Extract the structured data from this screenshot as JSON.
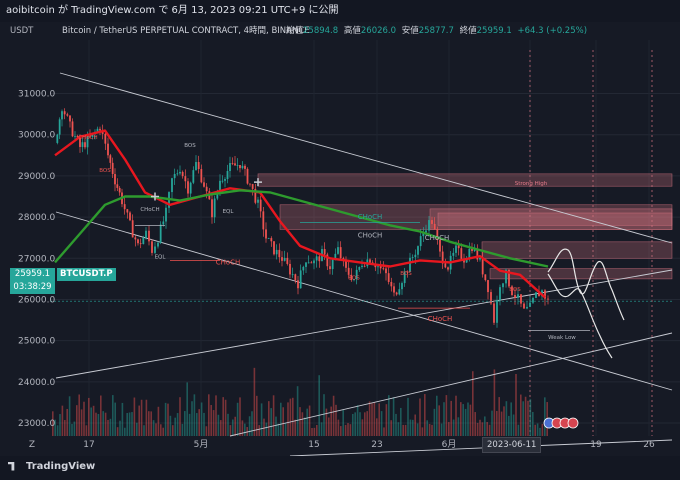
{
  "header": {
    "line": "aoibitcoin が TradingView.com で 6月 13, 2023 09:21 UTC+9 に公開"
  },
  "symbol_bar": {
    "currency": "USDT",
    "title": "Bitcoin / TetherUS PERPETUAL CONTRACT, 4時間, BINANCE",
    "ohlc": [
      {
        "label": "始値",
        "value": "25894.8"
      },
      {
        "label": "高値",
        "value": "26026.0"
      },
      {
        "label": "安値",
        "value": "25877.7"
      },
      {
        "label": "終値",
        "value": "25959.1"
      }
    ],
    "change": "+64.3 (+0.25%)"
  },
  "price_tag": {
    "price": "25959.1",
    "countdown": "03:38:29",
    "symbol": "BTCUSDT.P"
  },
  "cursor_date": "2023-06-11",
  "footer": {
    "brand": "TradingView"
  },
  "colors": {
    "background": "#161a25",
    "up": "#26a69a",
    "down": "#ef5350",
    "ma_fast": "#e8171f",
    "ma_slow": "#2e9b2e",
    "zone": "#d97583"
  },
  "chart_data": {
    "type": "candlestick",
    "title": "Bitcoin / TetherUS PERPETUAL CONTRACT, 4時間, BINANCE",
    "x_tick_labels": [
      "17",
      "5月",
      "15",
      "23",
      "6月",
      "12",
      "19",
      "26",
      "Z"
    ],
    "y_tick_labels": [
      "23000.0",
      "24000.0",
      "25000.0",
      "26000.0",
      "27000.0",
      "28000.0",
      "29000.0",
      "30000.0",
      "31000.0"
    ],
    "ylim": [
      22200,
      32300
    ],
    "last_close": 25959.1,
    "price_path": [
      {
        "x": 55,
        "p": 29800
      },
      {
        "x": 62,
        "p": 30700
      },
      {
        "x": 70,
        "p": 30200
      },
      {
        "x": 80,
        "p": 29700
      },
      {
        "x": 90,
        "p": 29900
      },
      {
        "x": 100,
        "p": 30200
      },
      {
        "x": 108,
        "p": 29500
      },
      {
        "x": 115,
        "p": 28900
      },
      {
        "x": 122,
        "p": 28400
      },
      {
        "x": 130,
        "p": 27800
      },
      {
        "x": 138,
        "p": 27300
      },
      {
        "x": 146,
        "p": 27600
      },
      {
        "x": 152,
        "p": 27200
      },
      {
        "x": 158,
        "p": 27500
      },
      {
        "x": 166,
        "p": 28100
      },
      {
        "x": 172,
        "p": 28900
      },
      {
        "x": 180,
        "p": 29200
      },
      {
        "x": 188,
        "p": 28700
      },
      {
        "x": 196,
        "p": 29300
      },
      {
        "x": 204,
        "p": 28800
      },
      {
        "x": 212,
        "p": 28100
      },
      {
        "x": 220,
        "p": 28900
      },
      {
        "x": 230,
        "p": 29200
      },
      {
        "x": 240,
        "p": 29300
      },
      {
        "x": 250,
        "p": 28800
      },
      {
        "x": 258,
        "p": 28300
      },
      {
        "x": 266,
        "p": 27500
      },
      {
        "x": 274,
        "p": 27200
      },
      {
        "x": 282,
        "p": 27000
      },
      {
        "x": 290,
        "p": 26700
      },
      {
        "x": 298,
        "p": 26400
      },
      {
        "x": 306,
        "p": 27000
      },
      {
        "x": 314,
        "p": 26900
      },
      {
        "x": 322,
        "p": 27100
      },
      {
        "x": 330,
        "p": 26800
      },
      {
        "x": 338,
        "p": 27200
      },
      {
        "x": 346,
        "p": 26700
      },
      {
        "x": 354,
        "p": 26500
      },
      {
        "x": 362,
        "p": 26900
      },
      {
        "x": 370,
        "p": 27000
      },
      {
        "x": 378,
        "p": 26800
      },
      {
        "x": 386,
        "p": 26600
      },
      {
        "x": 394,
        "p": 26100
      },
      {
        "x": 402,
        "p": 26500
      },
      {
        "x": 410,
        "p": 26900
      },
      {
        "x": 418,
        "p": 27300
      },
      {
        "x": 426,
        "p": 27800
      },
      {
        "x": 432,
        "p": 27900
      },
      {
        "x": 440,
        "p": 27100
      },
      {
        "x": 448,
        "p": 26800
      },
      {
        "x": 456,
        "p": 27200
      },
      {
        "x": 464,
        "p": 27000
      },
      {
        "x": 472,
        "p": 27300
      },
      {
        "x": 480,
        "p": 26900
      },
      {
        "x": 488,
        "p": 26300
      },
      {
        "x": 494,
        "p": 25500
      },
      {
        "x": 500,
        "p": 26400
      },
      {
        "x": 506,
        "p": 26600
      },
      {
        "x": 512,
        "p": 26200
      },
      {
        "x": 518,
        "p": 26000
      },
      {
        "x": 524,
        "p": 25700
      },
      {
        "x": 530,
        "p": 25800
      },
      {
        "x": 536,
        "p": 26100
      },
      {
        "x": 542,
        "p": 26200
      },
      {
        "x": 548,
        "p": 25960
      }
    ],
    "series": [
      {
        "name": "",
        "color": "#e8171f",
        "points": [
          {
            "x": 55,
            "p": 29500
          },
          {
            "x": 80,
            "p": 29950
          },
          {
            "x": 105,
            "p": 30100
          },
          {
            "x": 125,
            "p": 29400
          },
          {
            "x": 145,
            "p": 28600
          },
          {
            "x": 170,
            "p": 28300
          },
          {
            "x": 200,
            "p": 28500
          },
          {
            "x": 230,
            "p": 28700
          },
          {
            "x": 260,
            "p": 28600
          },
          {
            "x": 280,
            "p": 27900
          },
          {
            "x": 300,
            "p": 27300
          },
          {
            "x": 330,
            "p": 27000
          },
          {
            "x": 360,
            "p": 26900
          },
          {
            "x": 390,
            "p": 26800
          },
          {
            "x": 420,
            "p": 26950
          },
          {
            "x": 450,
            "p": 26900
          },
          {
            "x": 480,
            "p": 27050
          },
          {
            "x": 500,
            "p": 26700
          },
          {
            "x": 520,
            "p": 26600
          },
          {
            "x": 545,
            "p": 26050
          }
        ]
      },
      {
        "name": "",
        "color": "#2e9b2e",
        "points": [
          {
            "x": 55,
            "p": 26900
          },
          {
            "x": 80,
            "p": 27600
          },
          {
            "x": 105,
            "p": 28300
          },
          {
            "x": 125,
            "p": 28500
          },
          {
            "x": 150,
            "p": 28500
          },
          {
            "x": 180,
            "p": 28400
          },
          {
            "x": 210,
            "p": 28550
          },
          {
            "x": 240,
            "p": 28650
          },
          {
            "x": 270,
            "p": 28600
          },
          {
            "x": 300,
            "p": 28400
          },
          {
            "x": 330,
            "p": 28200
          },
          {
            "x": 360,
            "p": 28000
          },
          {
            "x": 390,
            "p": 27800
          },
          {
            "x": 420,
            "p": 27650
          },
          {
            "x": 450,
            "p": 27400
          },
          {
            "x": 480,
            "p": 27200
          },
          {
            "x": 510,
            "p": 27000
          },
          {
            "x": 548,
            "p": 26800
          }
        ]
      }
    ],
    "annotations": [
      "Strong High",
      "Weak Low",
      "CHoCH",
      "BOS",
      "EQL"
    ],
    "grid": true
  }
}
